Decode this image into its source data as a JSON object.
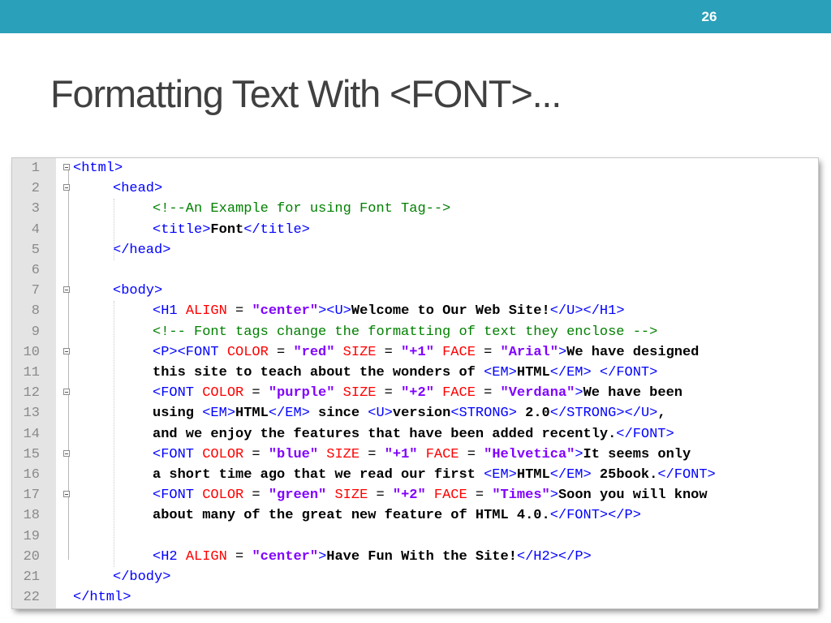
{
  "slide": {
    "number": "26",
    "title": "Formatting Text With <FONT>..."
  },
  "code_editor": {
    "lines": [
      {
        "n": "1",
        "indent": 0,
        "tokens": [
          [
            "tag",
            "<html>"
          ]
        ]
      },
      {
        "n": "2",
        "indent": 1,
        "tokens": [
          [
            "tag",
            "<head>"
          ]
        ]
      },
      {
        "n": "3",
        "indent": 2,
        "tokens": [
          [
            "comment",
            "<!--An Example for using Font Tag-->"
          ]
        ]
      },
      {
        "n": "4",
        "indent": 2,
        "tokens": [
          [
            "tag",
            "<title>"
          ],
          [
            "text",
            "Font"
          ],
          [
            "tag",
            "</title>"
          ]
        ]
      },
      {
        "n": "5",
        "indent": 1,
        "tokens": [
          [
            "tag",
            "</head>"
          ]
        ]
      },
      {
        "n": "6",
        "indent": 0,
        "tokens": []
      },
      {
        "n": "7",
        "indent": 1,
        "tokens": [
          [
            "tag",
            "<body>"
          ]
        ]
      },
      {
        "n": "8",
        "indent": 2,
        "tokens": [
          [
            "tag",
            "<H1 "
          ],
          [
            "attr",
            "ALIGN"
          ],
          [
            "eq",
            " = "
          ],
          [
            "val",
            "\"center\""
          ],
          [
            "tag",
            "><U>"
          ],
          [
            "text",
            "Welcome to Our Web Site!"
          ],
          [
            "tag",
            "</U></H1>"
          ]
        ]
      },
      {
        "n": "9",
        "indent": 2,
        "tokens": [
          [
            "comment",
            "<!-- Font tags change the formatting of text they enclose -->"
          ]
        ]
      },
      {
        "n": "10",
        "indent": 2,
        "tokens": [
          [
            "tag",
            "<P><FONT "
          ],
          [
            "attr",
            "COLOR"
          ],
          [
            "eq",
            " = "
          ],
          [
            "val",
            "\"red\""
          ],
          [
            "eq",
            " "
          ],
          [
            "attr",
            "SIZE"
          ],
          [
            "eq",
            " = "
          ],
          [
            "val",
            "\"+1\""
          ],
          [
            "eq",
            " "
          ],
          [
            "attr",
            "FACE"
          ],
          [
            "eq",
            " = "
          ],
          [
            "val",
            "\"Arial\""
          ],
          [
            "tag",
            ">"
          ],
          [
            "text",
            "We have designed"
          ]
        ]
      },
      {
        "n": "11",
        "indent": 2,
        "tokens": [
          [
            "text",
            "this site to teach about the wonders of "
          ],
          [
            "tag",
            "<EM>"
          ],
          [
            "text",
            "HTML"
          ],
          [
            "tag",
            "</EM>"
          ],
          [
            "eq",
            " "
          ],
          [
            "tag",
            "</FONT>"
          ]
        ]
      },
      {
        "n": "12",
        "indent": 2,
        "tokens": [
          [
            "tag",
            "<FONT "
          ],
          [
            "attr",
            "COLOR"
          ],
          [
            "eq",
            " = "
          ],
          [
            "val",
            "\"purple\""
          ],
          [
            "eq",
            " "
          ],
          [
            "attr",
            "SIZE"
          ],
          [
            "eq",
            " = "
          ],
          [
            "val",
            "\"+2\""
          ],
          [
            "eq",
            " "
          ],
          [
            "attr",
            "FACE"
          ],
          [
            "eq",
            " = "
          ],
          [
            "val",
            "\"Verdana\""
          ],
          [
            "tag",
            ">"
          ],
          [
            "text",
            "We have been"
          ]
        ]
      },
      {
        "n": "13",
        "indent": 2,
        "tokens": [
          [
            "text",
            "using "
          ],
          [
            "tag",
            "<EM>"
          ],
          [
            "text",
            "HTML"
          ],
          [
            "tag",
            "</EM>"
          ],
          [
            "text",
            " since "
          ],
          [
            "tag",
            "<U>"
          ],
          [
            "text",
            "version"
          ],
          [
            "tag",
            "<STRONG>"
          ],
          [
            "text",
            " 2.0"
          ],
          [
            "tag",
            "</STRONG></U>"
          ],
          [
            "text",
            ","
          ]
        ]
      },
      {
        "n": "14",
        "indent": 2,
        "tokens": [
          [
            "text",
            "and we enjoy the features that have been added recently."
          ],
          [
            "tag",
            "</FONT>"
          ]
        ]
      },
      {
        "n": "15",
        "indent": 2,
        "tokens": [
          [
            "tag",
            "<FONT "
          ],
          [
            "attr",
            "COLOR"
          ],
          [
            "eq",
            " = "
          ],
          [
            "val",
            "\"blue\""
          ],
          [
            "eq",
            " "
          ],
          [
            "attr",
            "SIZE"
          ],
          [
            "eq",
            " = "
          ],
          [
            "val",
            "\"+1\""
          ],
          [
            "eq",
            " "
          ],
          [
            "attr",
            "FACE"
          ],
          [
            "eq",
            " = "
          ],
          [
            "val",
            "\"Helvetica\""
          ],
          [
            "tag",
            ">"
          ],
          [
            "text",
            "It seems only"
          ]
        ]
      },
      {
        "n": "16",
        "indent": 2,
        "tokens": [
          [
            "text",
            "a short time ago that we read our first "
          ],
          [
            "tag",
            "<EM>"
          ],
          [
            "text",
            "HTML"
          ],
          [
            "tag",
            "</EM>"
          ],
          [
            "text",
            " 25book."
          ],
          [
            "tag",
            "</FONT>"
          ]
        ]
      },
      {
        "n": "17",
        "indent": 2,
        "tokens": [
          [
            "tag",
            "<FONT "
          ],
          [
            "attr",
            "COLOR"
          ],
          [
            "eq",
            " = "
          ],
          [
            "val",
            "\"green\""
          ],
          [
            "eq",
            " "
          ],
          [
            "attr",
            "SIZE"
          ],
          [
            "eq",
            " = "
          ],
          [
            "val",
            "\"+2\""
          ],
          [
            "eq",
            " "
          ],
          [
            "attr",
            "FACE"
          ],
          [
            "eq",
            " = "
          ],
          [
            "val",
            "\"Times\""
          ],
          [
            "tag",
            ">"
          ],
          [
            "text",
            "Soon you will know"
          ]
        ]
      },
      {
        "n": "18",
        "indent": 2,
        "tokens": [
          [
            "text",
            "about many of the great new feature of HTML 4.0."
          ],
          [
            "tag",
            "</FONT></P>"
          ]
        ]
      },
      {
        "n": "19",
        "indent": 0,
        "tokens": []
      },
      {
        "n": "20",
        "indent": 2,
        "tokens": [
          [
            "tag",
            "<H2 "
          ],
          [
            "attr",
            "ALIGN"
          ],
          [
            "eq",
            " = "
          ],
          [
            "val",
            "\"center\""
          ],
          [
            "tag",
            ">"
          ],
          [
            "text",
            "Have Fun With the Site!"
          ],
          [
            "tag",
            "</H2></P>"
          ]
        ]
      },
      {
        "n": "21",
        "indent": 1,
        "tokens": [
          [
            "tag",
            "</body>"
          ]
        ]
      },
      {
        "n": "22",
        "indent": 0,
        "tokens": [
          [
            "tag",
            "</html>"
          ]
        ]
      }
    ],
    "fold_markers": [
      "1",
      "2",
      "7",
      "10",
      "12",
      "15",
      "17"
    ],
    "colors": {
      "tag": "#0000ff",
      "attribute": "#ff0000",
      "value": "#8000ff",
      "comment": "#008000",
      "text": "#000000",
      "line_number": "#8a8a8a",
      "gutter": "#e4e4e4"
    }
  },
  "theme": {
    "top_bar": "#2aa0ba",
    "title_color": "#404040"
  }
}
